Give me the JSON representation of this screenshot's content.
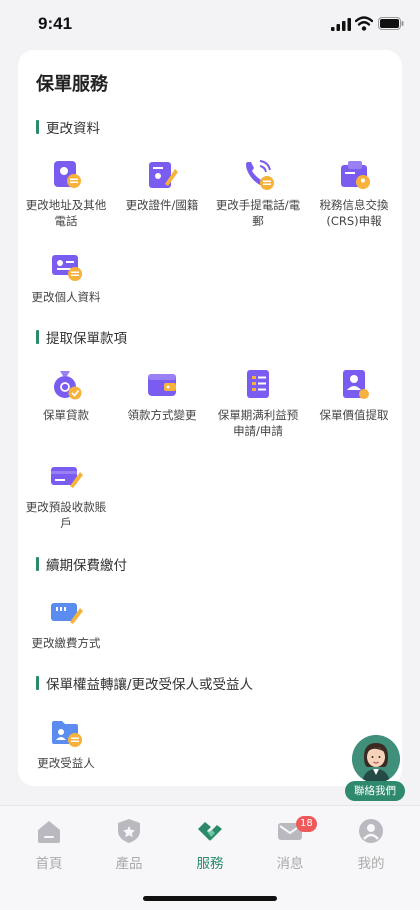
{
  "status_bar": {
    "time": "9:41"
  },
  "page": {
    "title": "保單服務"
  },
  "sections": [
    {
      "title": "更改資料",
      "items": [
        {
          "label": "更改地址及其他電話",
          "icon": "address-book-icon"
        },
        {
          "label": "更改證件/國籍",
          "icon": "id-document-icon"
        },
        {
          "label": "更改手提電話/電郵",
          "icon": "phone-icon"
        },
        {
          "label": "稅務信息交換(CRS)申報",
          "icon": "tax-folder-icon"
        },
        {
          "label": "更改個人資料",
          "icon": "profile-card-icon"
        }
      ]
    },
    {
      "title": "提取保單款項",
      "items": [
        {
          "label": "保單貸款",
          "icon": "money-bag-icon"
        },
        {
          "label": "領款方式變更",
          "icon": "wallet-icon"
        },
        {
          "label": "保單期满利益预申請/申請",
          "icon": "checklist-icon"
        },
        {
          "label": "保單價值提取",
          "icon": "person-document-icon"
        },
        {
          "label": "更改預設收款賬戶",
          "icon": "bank-card-edit-icon"
        }
      ]
    },
    {
      "title": "續期保費繳付",
      "items": [
        {
          "label": "更改繳費方式",
          "icon": "payment-card-icon"
        }
      ]
    },
    {
      "title": "保單權益轉讓/更改受保人或受益人",
      "items": [
        {
          "label": "更改受益人",
          "icon": "beneficiary-folder-icon"
        }
      ]
    }
  ],
  "contact": {
    "label": "聯絡我們"
  },
  "tabbar": {
    "tabs": [
      {
        "label": "首頁",
        "icon": "home-icon"
      },
      {
        "label": "產品",
        "icon": "shield-star-icon"
      },
      {
        "label": "服務",
        "icon": "handshake-icon",
        "active": true
      },
      {
        "label": "消息",
        "icon": "mail-icon",
        "badge": "18"
      },
      {
        "label": "我的",
        "icon": "user-icon"
      }
    ]
  },
  "colors": {
    "accent": "#2a8a6a",
    "icon_purple": "#7b5cf0",
    "icon_orange": "#f7b23b",
    "badge": "#f0595a"
  }
}
